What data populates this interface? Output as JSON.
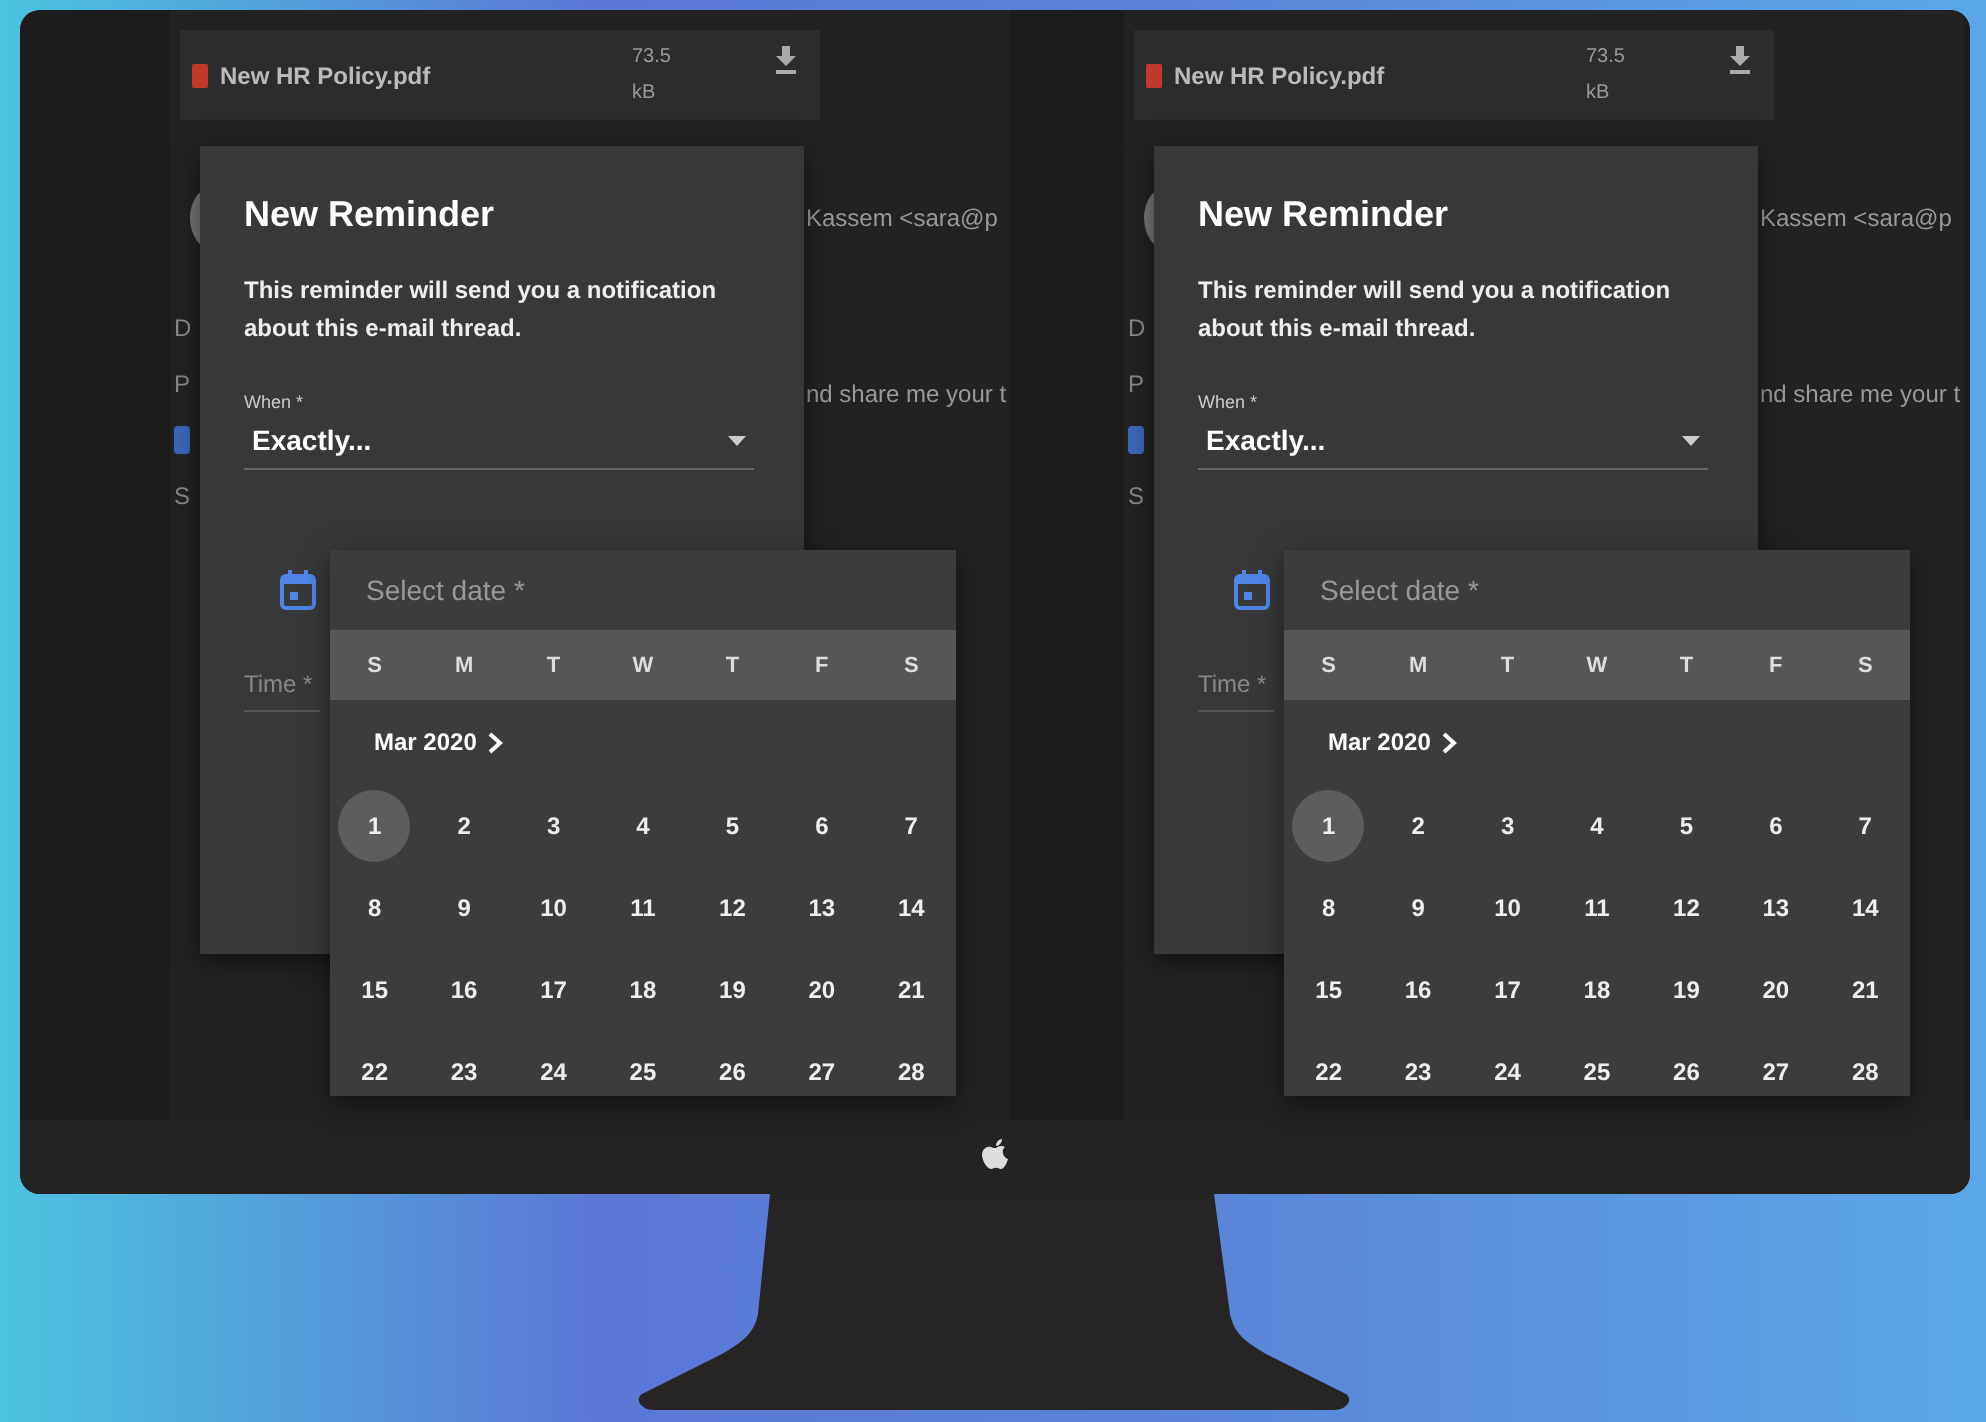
{
  "panes": [
    {
      "attachment": {
        "name": "New HR Policy.pdf",
        "size": "73.5",
        "unit": "kB"
      },
      "email": {
        "sender": "Kassem <sara@p",
        "body": "nd share me your t",
        "edge_letters": [
          "D",
          "P",
          "S"
        ]
      },
      "dialog": {
        "title": "New Reminder",
        "description": "This reminder will send you a notification about this e-mail thread.",
        "when_label": "When *",
        "when_value": "Exactly...",
        "time_label": "Time *"
      },
      "date_picker": {
        "label": "Select date *",
        "weekdays": [
          "S",
          "M",
          "T",
          "W",
          "T",
          "F",
          "S"
        ],
        "month": "Mar 2020",
        "days": [
          {
            "label": "1",
            "selected": true
          },
          {
            "label": "2",
            "selected": false
          },
          {
            "label": "3",
            "selected": false
          },
          {
            "label": "4",
            "selected": false
          },
          {
            "label": "5",
            "selected": false
          },
          {
            "label": "6",
            "selected": false
          },
          {
            "label": "7",
            "selected": false
          },
          {
            "label": "8",
            "selected": false
          },
          {
            "label": "9",
            "selected": false
          },
          {
            "label": "10",
            "selected": false
          },
          {
            "label": "11",
            "selected": false
          },
          {
            "label": "12",
            "selected": false
          },
          {
            "label": "13",
            "selected": false
          },
          {
            "label": "14",
            "selected": false
          },
          {
            "label": "15",
            "selected": false
          },
          {
            "label": "16",
            "selected": false
          },
          {
            "label": "17",
            "selected": false
          },
          {
            "label": "18",
            "selected": false
          },
          {
            "label": "19",
            "selected": false
          },
          {
            "label": "20",
            "selected": false
          },
          {
            "label": "21",
            "selected": false
          },
          {
            "label": "22",
            "selected": false
          },
          {
            "label": "23",
            "selected": false
          },
          {
            "label": "24",
            "selected": false
          },
          {
            "label": "25",
            "selected": false
          },
          {
            "label": "26",
            "selected": false
          },
          {
            "label": "27",
            "selected": false
          },
          {
            "label": "28",
            "selected": false
          }
        ]
      }
    },
    {
      "attachment": {
        "name": "New HR Policy.pdf",
        "size": "73.5",
        "unit": "kB"
      },
      "email": {
        "sender": "Kassem <sara@p",
        "body": "nd share me your t",
        "edge_letters": [
          "D",
          "P",
          "S"
        ]
      },
      "dialog": {
        "title": "New Reminder",
        "description": "This reminder will send you a notification about this e-mail thread.",
        "when_label": "When *",
        "when_value": "Exactly...",
        "time_label": "Time *"
      },
      "date_picker": {
        "label": "Select date *",
        "weekdays": [
          "S",
          "M",
          "T",
          "W",
          "T",
          "F",
          "S"
        ],
        "month": "Mar 2020",
        "days": [
          {
            "label": "1",
            "selected": true
          },
          {
            "label": "2",
            "selected": false
          },
          {
            "label": "3",
            "selected": false
          },
          {
            "label": "4",
            "selected": false
          },
          {
            "label": "5",
            "selected": false
          },
          {
            "label": "6",
            "selected": false
          },
          {
            "label": "7",
            "selected": false
          },
          {
            "label": "8",
            "selected": false
          },
          {
            "label": "9",
            "selected": false
          },
          {
            "label": "10",
            "selected": false
          },
          {
            "label": "11",
            "selected": false
          },
          {
            "label": "12",
            "selected": false
          },
          {
            "label": "13",
            "selected": false
          },
          {
            "label": "14",
            "selected": false
          },
          {
            "label": "15",
            "selected": false
          },
          {
            "label": "16",
            "selected": false
          },
          {
            "label": "17",
            "selected": false
          },
          {
            "label": "18",
            "selected": false
          },
          {
            "label": "19",
            "selected": false
          },
          {
            "label": "20",
            "selected": false
          },
          {
            "label": "21",
            "selected": false
          },
          {
            "label": "22",
            "selected": false
          },
          {
            "label": "23",
            "selected": false
          },
          {
            "label": "24",
            "selected": false
          },
          {
            "label": "25",
            "selected": false
          },
          {
            "label": "26",
            "selected": false
          },
          {
            "label": "27",
            "selected": false
          },
          {
            "label": "28",
            "selected": false
          }
        ]
      }
    }
  ]
}
